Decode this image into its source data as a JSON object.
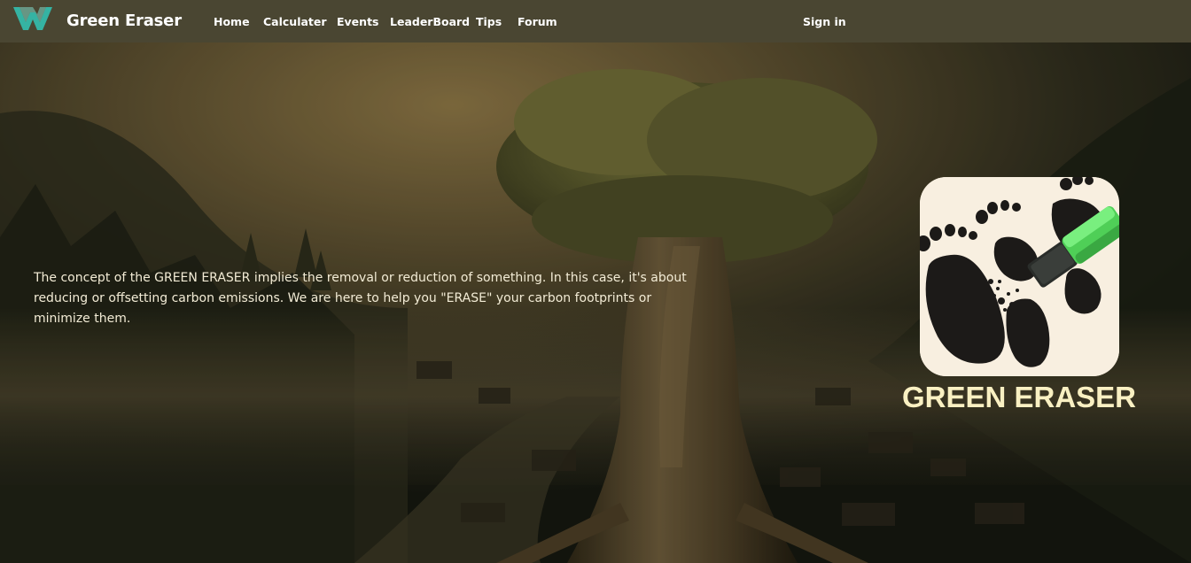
{
  "nav": {
    "brand": "Green Eraser",
    "links": [
      "Home",
      "Calculater",
      "Events",
      "LeaderBoard",
      "Tips",
      "Forum"
    ],
    "sign_in": "Sign in"
  },
  "hero": {
    "intro": "The concept of the GREEN ERASER implies the removal or reduction of something. In this case, it's about reducing or offsetting carbon emissions. We are here to help you \"ERASE\" your carbon footprints or minimize them.",
    "logo_title": "GREEN ERASER"
  },
  "colors": {
    "navbar": "#4a4632",
    "logo_teal": "#35b3a3",
    "eraser_green": "#5ee066",
    "title_text": "#f9f0c2"
  },
  "icons": {
    "site_logo": "w-logo-icon",
    "hero_image": "footprints-eraser-image"
  }
}
